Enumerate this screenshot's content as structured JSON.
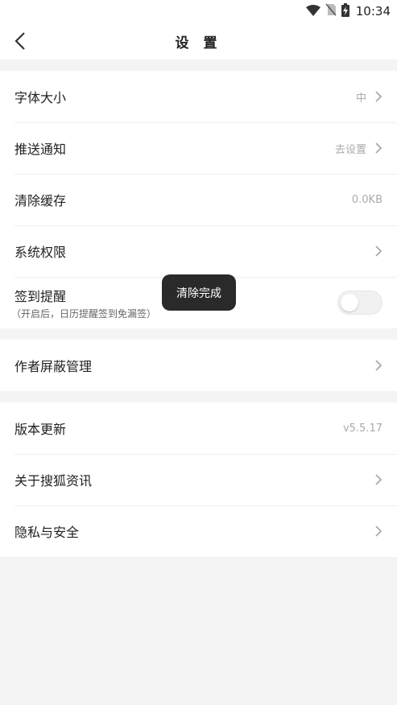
{
  "status_bar": {
    "time": "10:34"
  },
  "header": {
    "title": "设 置"
  },
  "settings": {
    "font_size": {
      "label": "字体大小",
      "value": "中"
    },
    "push": {
      "label": "推送通知",
      "value": "去设置"
    },
    "cache": {
      "label": "清除缓存",
      "value": "0.0KB"
    },
    "permissions": {
      "label": "系统权限"
    },
    "checkin": {
      "label": "签到提醒",
      "sub": "（开启后，日历提醒签到免漏签）",
      "enabled": false
    },
    "blocked_authors": {
      "label": "作者屏蔽管理"
    },
    "version": {
      "label": "版本更新",
      "value": "v5.5.17"
    },
    "about": {
      "label": "关于搜狐资讯"
    },
    "privacy": {
      "label": "隐私与安全"
    }
  },
  "toast": {
    "text": "清除完成"
  }
}
